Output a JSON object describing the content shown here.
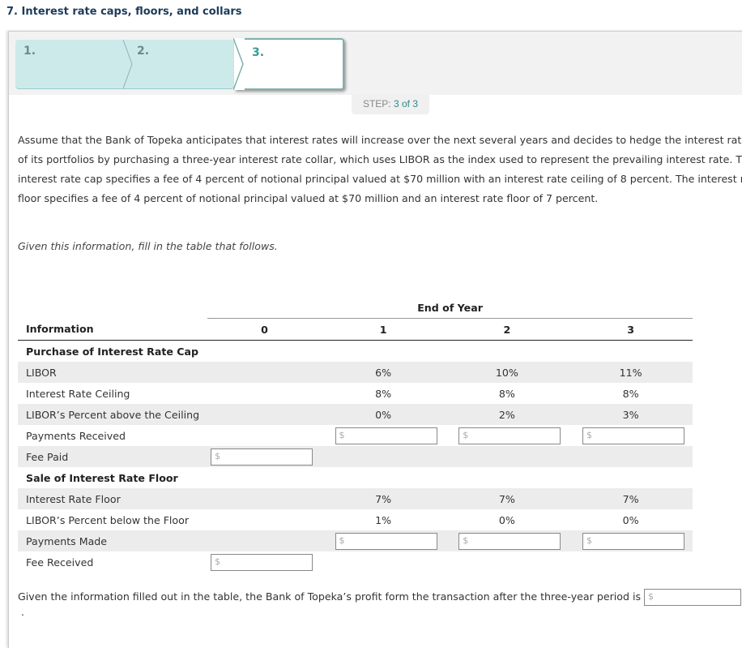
{
  "title": "7. Interest rate caps, floors, and collars",
  "steps": [
    "1.",
    "2.",
    "3."
  ],
  "step_indicator": {
    "label": "STEP:",
    "value": "3 of 3"
  },
  "paragraph": "Assume that the Bank of Topeka anticipates that interest rates will increase over the next several years and decides to hedge the interest rate risk of its portfolios by purchasing a three-year interest rate collar, which uses LIBOR as the index used to represent the prevailing interest rate. The interest rate cap specifies a fee of 4 percent of notional principal valued at $70 million with an interest rate ceiling of 8 percent. The interest rate floor specifies a fee of 4 percent of notional principal valued at $70 million and an interest rate floor of 7 percent.",
  "instruction": "Given this information, fill in the table that follows.",
  "table": {
    "group_header": "End of Year",
    "columns": [
      "Information",
      "0",
      "1",
      "2",
      "3"
    ],
    "cap_header": "Purchase of Interest Rate Cap",
    "floor_header": "Sale of Interest Rate Floor",
    "rows": {
      "libor": {
        "label": "LIBOR",
        "values": [
          "",
          "6%",
          "10%",
          "11%"
        ]
      },
      "ceiling": {
        "label": "Interest Rate Ceiling",
        "values": [
          "",
          "8%",
          "8%",
          "8%"
        ]
      },
      "above": {
        "label": "LIBOR’s Percent above the Ceiling",
        "values": [
          "",
          "0%",
          "2%",
          "3%"
        ]
      },
      "payments_received": {
        "label": "Payments Received"
      },
      "fee_paid": {
        "label": "Fee Paid"
      },
      "floor": {
        "label": "Interest Rate Floor",
        "values": [
          "",
          "7%",
          "7%",
          "7%"
        ]
      },
      "below": {
        "label": "LIBOR’s Percent below the Floor",
        "values": [
          "",
          "1%",
          "0%",
          "0%"
        ]
      },
      "payments_made": {
        "label": "Payments Made"
      },
      "fee_received": {
        "label": "Fee Received"
      }
    },
    "currency": "$"
  },
  "final": {
    "text": "Given the information filled out in the table, the Bank of Topeka’s profit form the transaction after the three-year period is",
    "suffix": "."
  }
}
